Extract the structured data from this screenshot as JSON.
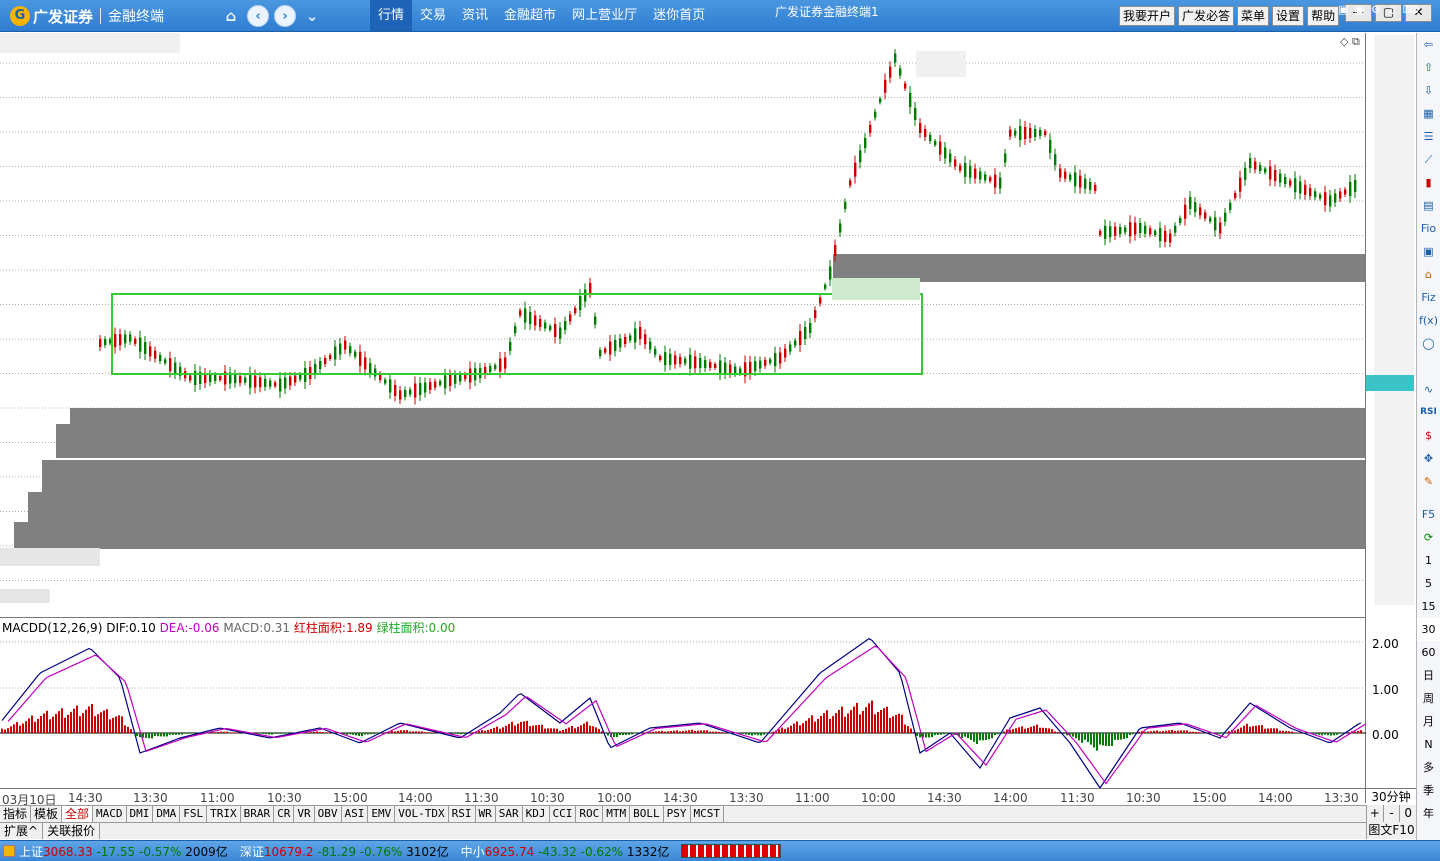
{
  "app": {
    "logo_text": "广发证券",
    "logo_sub": "金融终端",
    "nav_icons": [
      "home-icon",
      "back-icon",
      "forward-icon",
      "collapse-icon"
    ]
  },
  "topnav": [
    "行情",
    "交易",
    "资讯",
    "金融超市",
    "网上营业厅",
    "迷你首页"
  ],
  "topnav_active": 0,
  "right_buttons": [
    "我要开户",
    "广发必答",
    "菜单",
    "设置",
    "帮助"
  ],
  "window_controls": [
    "minimize-icon",
    "maximize-icon",
    "close-icon"
  ],
  "macd": {
    "name": "MACDD(12,26,9)",
    "dif_label": "DIF:",
    "dif": "0.10",
    "dea_label": "DEA:",
    "dea": "-0.06",
    "macd_label": "MACD:",
    "macd": "0.31",
    "red_label": "红柱面积:",
    "red": "1.89",
    "green_label": "绿柱面积:",
    "green": "0.00",
    "axis": [
      "2.00",
      "1.00",
      "0.00"
    ]
  },
  "time_axis": [
    "03月10日",
    "14:30",
    "13:30",
    "11:00",
    "10:30",
    "15:00",
    "14:00",
    "11:30",
    "10:30",
    "10:00",
    "14:30",
    "13:30",
    "11:00",
    "10:00",
    "14:30",
    "14:00",
    "11:30",
    "10:30",
    "15:00",
    "14:00",
    "13:30"
  ],
  "period": "30分钟",
  "indicator_tabs": [
    "指标",
    "模板",
    "全部",
    "MACD",
    "DMI",
    "DMA",
    "FSL",
    "TRIX",
    "BRAR",
    "CR",
    "VR",
    "OBV",
    "ASI",
    "EMV",
    "VOL-TDX",
    "RSI",
    "WR",
    "SAR",
    "KDJ",
    "CCI",
    "ROC",
    "MTM",
    "BOLL",
    "PSY",
    "MCST"
  ],
  "indicator_active": 2,
  "ext_tabs": [
    "扩展^",
    "关联报价"
  ],
  "scroll": [
    "+",
    "-",
    "0"
  ],
  "f10": "图文F10",
  "right_toolbar": [
    "arrow-left-icon",
    "arrow-up-icon",
    "arrow-down-icon",
    "table-icon",
    "list-icon",
    "line-chart-icon",
    "candle-icon",
    "doc-icon",
    "fio-icon",
    "calendar-icon",
    "bank-icon",
    "fiz-icon",
    "fx-icon",
    "circle-icon",
    "",
    "",
    "wave-icon",
    "rsi-icon",
    "dollar-icon",
    "move-icon",
    "pencil-icon",
    "",
    "f5-icon",
    "refresh-icon"
  ],
  "right_toolbar_text": {
    "fio": "Fio",
    "fiz": "Fiz",
    "fx": "f(x)",
    "rsi": "RSI",
    "f5": "F5",
    "s": "$"
  },
  "periods": [
    "1",
    "5",
    "15",
    "30",
    "60",
    "日",
    "周",
    "月",
    "N",
    "多",
    "季",
    "年"
  ],
  "status": {
    "indices": [
      {
        "name": "上证",
        "value": "3068.33",
        "chg": "-17.55",
        "pct": "-0.57%",
        "amt": "2009亿"
      },
      {
        "name": "深证",
        "value": "10679.2",
        "chg": "-81.29",
        "pct": "-0.76%",
        "amt": "3102亿"
      },
      {
        "name": "中小",
        "value": "6925.74",
        "chg": "-43.32",
        "pct": "-0.62%",
        "amt": "1332亿"
      }
    ],
    "title": "广发证券金融终端1"
  },
  "colors": {
    "up": "#cc0000",
    "down": "#007a00",
    "dif": "#000080",
    "dea": "#c000c0",
    "box": "#33cc33",
    "bar": "#808080",
    "accent": "#2f7dd1"
  }
}
